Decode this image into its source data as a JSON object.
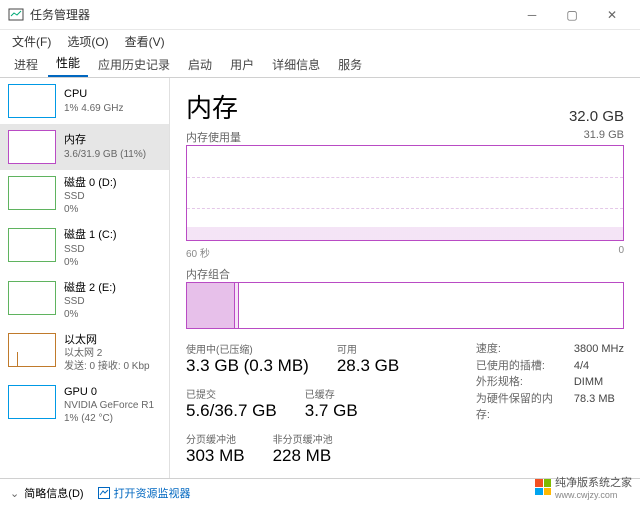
{
  "window": {
    "title": "任务管理器"
  },
  "menus": {
    "file": "文件(F)",
    "options": "选项(O)",
    "view": "查看(V)"
  },
  "tabs": {
    "processes": "进程",
    "performance": "性能",
    "history": "应用历史记录",
    "startup": "启动",
    "users": "用户",
    "details": "详细信息",
    "services": "服务"
  },
  "sidebar": {
    "items": [
      {
        "name": "CPU",
        "sub": "1%  4.69 GHz"
      },
      {
        "name": "内存",
        "sub": "3.6/31.9 GB (11%)"
      },
      {
        "name": "磁盘 0 (D:)",
        "sub1": "SSD",
        "sub2": "0%"
      },
      {
        "name": "磁盘 1 (C:)",
        "sub1": "SSD",
        "sub2": "0%"
      },
      {
        "name": "磁盘 2 (E:)",
        "sub1": "SSD",
        "sub2": "0%"
      },
      {
        "name": "以太网",
        "sub1": "以太网 2",
        "sub2": "发送: 0  接收: 0 Kbp"
      },
      {
        "name": "GPU 0",
        "sub1": "NVIDIA GeForce R1",
        "sub2": "1%  (42 °C)"
      }
    ]
  },
  "main": {
    "title": "内存",
    "total": "32.0 GB",
    "usage_label": "内存使用量",
    "usage_max": "31.9 GB",
    "time_left": "60 秒",
    "time_right": "0",
    "compose_label": "内存组合",
    "used_label": "使用中(已压缩)",
    "used_val": "3.3 GB (0.3 MB)",
    "avail_label": "可用",
    "avail_val": "28.3 GB",
    "commit_label": "已提交",
    "commit_val": "5.6/36.7 GB",
    "cached_label": "已缓存",
    "cached_val": "3.7 GB",
    "paged_label": "分页缓冲池",
    "paged_val": "303 MB",
    "nonpaged_label": "非分页缓冲池",
    "nonpaged_val": "228 MB",
    "info": {
      "speed_k": "速度:",
      "speed_v": "3800 MHz",
      "slots_k": "已使用的插槽:",
      "slots_v": "4/4",
      "form_k": "外形规格:",
      "form_v": "DIMM",
      "hw_k": "为硬件保留的内存:",
      "hw_v": "78.3 MB"
    }
  },
  "status": {
    "brief": "简略信息(D)",
    "resmon": "打开资源监视器"
  },
  "watermark": {
    "text": "纯净版系统之家",
    "url": "www.cwjzy.com"
  },
  "chart_data": {
    "type": "area",
    "title": "内存使用量",
    "xlabel": "秒",
    "ylabel": "GB",
    "ylim": [
      0,
      31.9
    ],
    "x_range": [
      60,
      0
    ],
    "series": [
      {
        "name": "使用中",
        "values_approx": "flat ≈ 3.6 GB across 60s"
      }
    ]
  }
}
